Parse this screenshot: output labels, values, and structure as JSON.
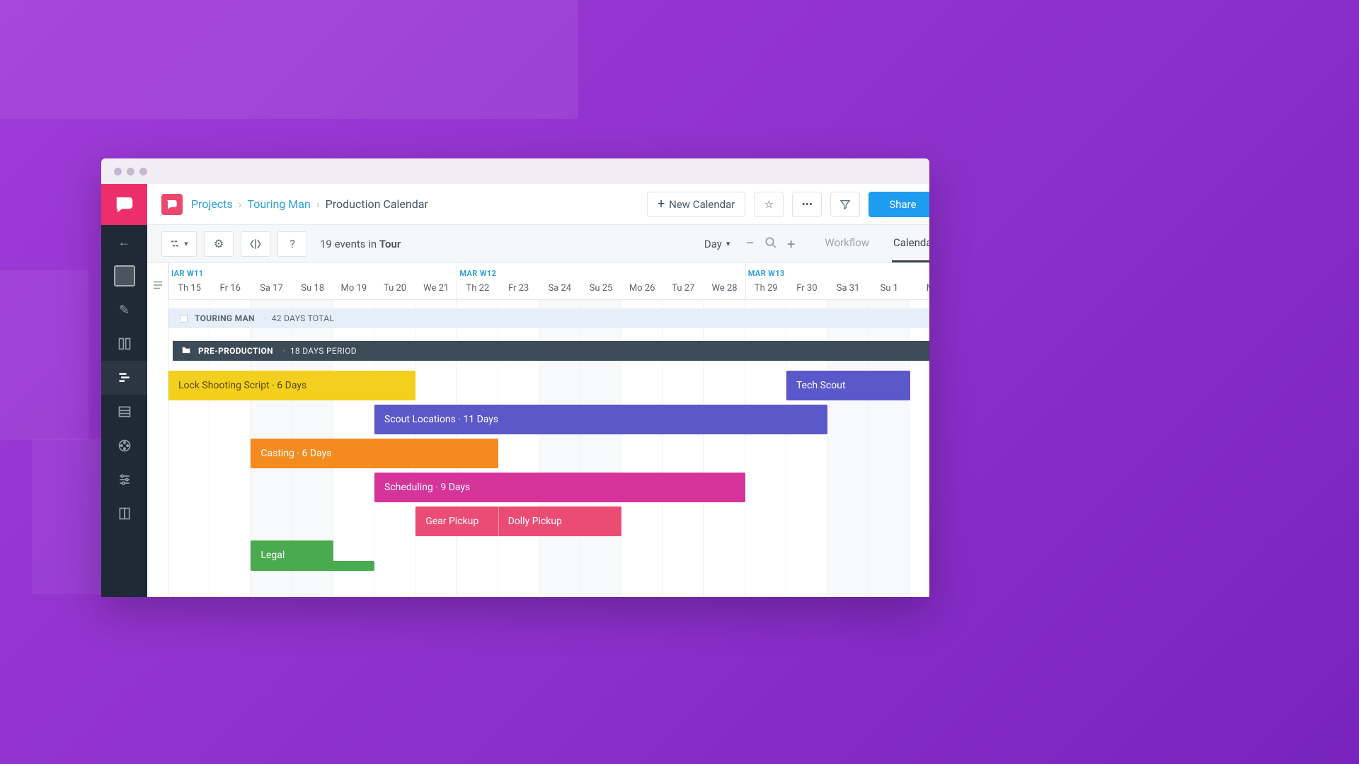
{
  "breadcrumb": {
    "root": "Projects",
    "project": "Touring Man",
    "current": "Production Calendar"
  },
  "header": {
    "new_calendar": "New Calendar",
    "share": "Share"
  },
  "toolbar": {
    "events_prefix": "19 events in ",
    "events_context": "Tour",
    "scale_label": "Day",
    "tab_workflow": "Workflow",
    "tab_calendar": "Calendar"
  },
  "weeks": [
    {
      "label": "IAR  W11",
      "col": 0
    },
    {
      "label": "MAR  W12",
      "col": 7
    },
    {
      "label": "MAR  W13",
      "col": 14
    }
  ],
  "days": [
    "Th 15",
    "Fr 16",
    "Sa 17",
    "Su 18",
    "Mo 19",
    "Tu 20",
    "We 21",
    "Th 22",
    "Fr 23",
    "Sa 24",
    "Su 25",
    "Mo 26",
    "Tu 27",
    "We 28",
    "Th 29",
    "Fr 30",
    "Sa 31",
    "Su 1",
    "M"
  ],
  "summary": {
    "title": "TOURING MAN",
    "meta": "42 DAYS TOTAL"
  },
  "phase": {
    "title": "PRE-PRODUCTION",
    "meta": "18 DAYS PERIOD"
  },
  "events": [
    {
      "label": "Lock Shooting Script · 6 Days",
      "color": "yellow",
      "start": 0,
      "span": 6,
      "row": 0,
      "under_span": 4
    },
    {
      "label": "Tech Scout",
      "color": "indigo",
      "start": 15,
      "span": 3,
      "row": 0
    },
    {
      "label": "Scout Locations · 11 Days",
      "color": "indigo",
      "start": 5,
      "span": 11,
      "row": 1
    },
    {
      "label": "Casting · 6 Days",
      "color": "orange",
      "start": 2,
      "span": 6,
      "row": 2,
      "under_span": 4
    },
    {
      "label": "Scheduling · 9 Days",
      "color": "magenta",
      "start": 5,
      "span": 9,
      "row": 3
    },
    {
      "label": "Gear Pickup",
      "label2": "Dolly Pickup",
      "color": "pink",
      "start": 6,
      "span": 5,
      "row": 4,
      "split": 2,
      "under_span": 1
    },
    {
      "label": "Legal",
      "color": "green",
      "start": 2,
      "span": 2,
      "row": 5
    },
    {
      "label": "",
      "color": "green",
      "start": 2,
      "span": 3,
      "row": 5.6,
      "thin": true
    }
  ],
  "colw": 58.2
}
